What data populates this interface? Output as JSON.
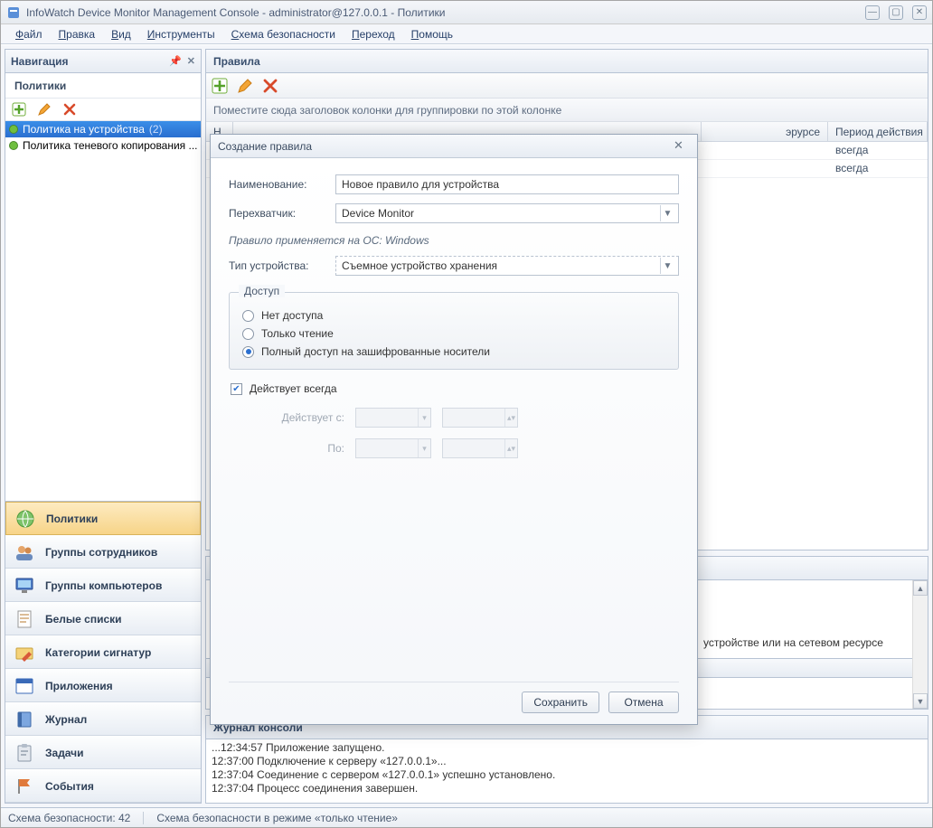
{
  "titlebar": {
    "title": "InfoWatch Device Monitor Management Console - administrator@127.0.0.1 - Политики"
  },
  "menu": [
    "Файл",
    "Правка",
    "Вид",
    "Инструменты",
    "Схема безопасности",
    "Переход",
    "Помощь"
  ],
  "nav": {
    "header": "Навигация",
    "subheader": "Политики",
    "tree": [
      {
        "label": "Политика на устройства",
        "count": "(2)",
        "selected": true
      },
      {
        "label": "Политика теневого копирования ...",
        "selected": false
      }
    ],
    "buttons": [
      {
        "label": "Политики",
        "icon": "globe",
        "active": true
      },
      {
        "label": "Группы сотрудников",
        "icon": "users"
      },
      {
        "label": "Группы компьютеров",
        "icon": "monitor"
      },
      {
        "label": "Белые списки",
        "icon": "doc-list"
      },
      {
        "label": "Категории сигнатур",
        "icon": "folder-pen"
      },
      {
        "label": "Приложения",
        "icon": "window"
      },
      {
        "label": "Журнал",
        "icon": "book"
      },
      {
        "label": "Задачи",
        "icon": "clipboard"
      },
      {
        "label": "События",
        "icon": "flag"
      }
    ]
  },
  "rules": {
    "title": "Правила",
    "group_hint": "Поместите сюда заголовок колонки для группировки по этой колонке",
    "columns": [
      "Н...",
      "эрурсе",
      "Период действия"
    ],
    "rows": [
      {
        "c2": "",
        "c3": "всегда"
      },
      {
        "c2": "",
        "c3": "всегда"
      }
    ]
  },
  "details": {
    "visible_text": "устройстве или на сетевом ресурсе"
  },
  "console": {
    "title": "Журнал консоли",
    "lines": [
      "...12:34:57 Приложение запущено.",
      "12:37:00 Подключение к серверу «127.0.0.1»...",
      "12:37:04 Соединение с сервером «127.0.0.1» успешно установлено.",
      "12:37:04 Процесс соединения завершен."
    ]
  },
  "statusbar": {
    "left": "Схема безопасности: 42",
    "mid": "Схема безопасности в режиме «только чтение»"
  },
  "dialog": {
    "title": "Создание правила",
    "name_label": "Наименование:",
    "name_value": "Новое правило для устройства",
    "interceptor_label": "Перехватчик:",
    "interceptor_value": "Device Monitor",
    "os_note": "Правило применяется на ОС:  Windows",
    "devtype_label": "Тип устройства:",
    "devtype_value": "Съемное устройство хранения",
    "access_legend": "Доступ",
    "radios": [
      {
        "label": "Нет доступа",
        "checked": false
      },
      {
        "label": "Только чтение",
        "checked": false
      },
      {
        "label": "Полный доступ на зашифрованные носители",
        "checked": true
      }
    ],
    "always_label": "Действует всегда",
    "from_label": "Действует с:",
    "to_label": "По:",
    "save": "Сохранить",
    "cancel": "Отмена"
  }
}
